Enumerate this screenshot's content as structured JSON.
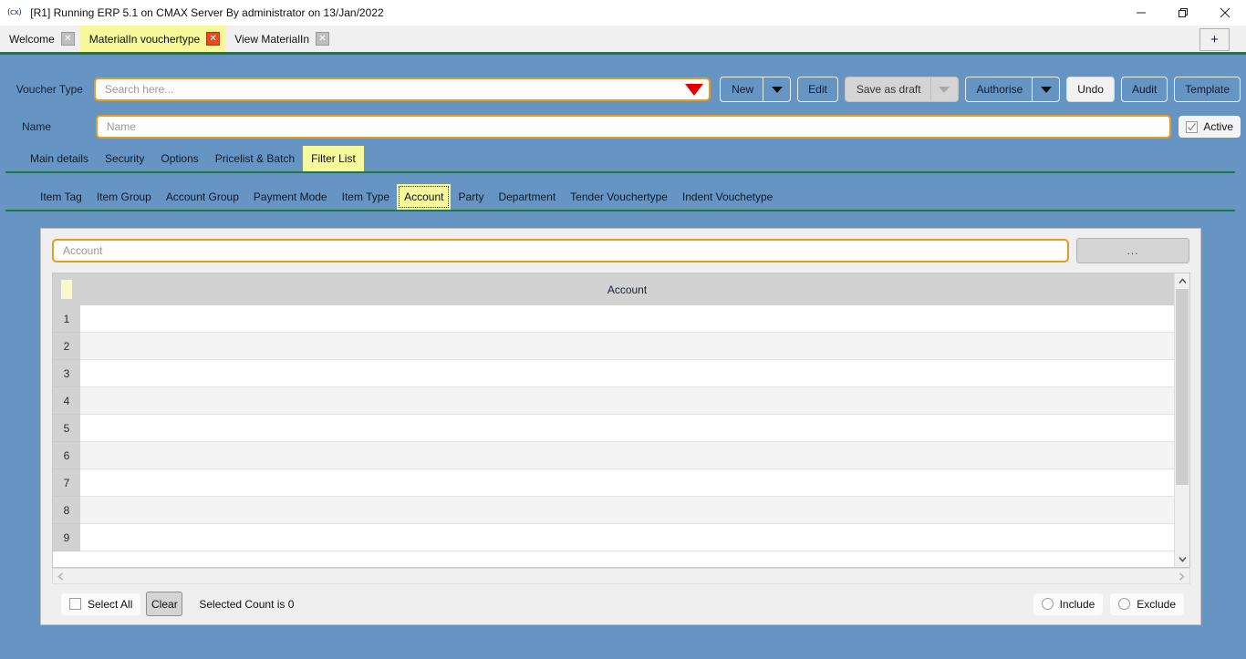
{
  "window": {
    "title": "[R1] Running ERP 5.1 on CMAX Server By administrator on 13/Jan/2022",
    "app_glyph": "(cx)",
    "minimize_icon": "minimize-icon",
    "maximize_icon": "maximize-icon",
    "close_icon": "close-icon"
  },
  "tabstrip": {
    "new_tab_label": "+",
    "tabs": [
      {
        "label": "Welcome",
        "active": false,
        "close_icon": "close-icon"
      },
      {
        "label": "MaterialIn vouchertype",
        "active": true,
        "close_icon": "close-icon"
      },
      {
        "label": "View MaterialIn",
        "active": false,
        "close_icon": "close-icon"
      }
    ]
  },
  "form": {
    "voucher_type_label": "Voucher Type",
    "voucher_type_placeholder": "Search here...",
    "voucher_type_value": "",
    "dropdown_icon": "caret-down-icon",
    "name_label": "Name",
    "name_placeholder": "Name",
    "name_value": "",
    "active_label": "Active",
    "active_checked": true
  },
  "toolbar": {
    "new_label": "New",
    "edit_label": "Edit",
    "save_as_draft_label": "Save as draft",
    "authorise_label": "Authorise",
    "undo_label": "Undo",
    "audit_label": "Audit",
    "template_label": "Template"
  },
  "tabs_primary": [
    {
      "label": "Main details",
      "active": false
    },
    {
      "label": "Security",
      "active": false
    },
    {
      "label": "Options",
      "active": false
    },
    {
      "label": "Pricelist & Batch",
      "active": false
    },
    {
      "label": "Filter List",
      "active": true
    }
  ],
  "tabs_secondary": [
    {
      "label": "Item Tag",
      "active": false
    },
    {
      "label": "Item Group",
      "active": false
    },
    {
      "label": "Account Group",
      "active": false
    },
    {
      "label": "Payment Mode",
      "active": false
    },
    {
      "label": "Item Type",
      "active": false
    },
    {
      "label": "Account",
      "active": true
    },
    {
      "label": "Party",
      "active": false
    },
    {
      "label": "Department",
      "active": false
    },
    {
      "label": "Tender Vouchertype",
      "active": false
    },
    {
      "label": "Indent Vouchetype",
      "active": false
    }
  ],
  "filter_panel": {
    "account_placeholder": "Account",
    "account_value": "",
    "browse_button_label": "...",
    "grid": {
      "column_header": "Account",
      "rows": [
        {
          "number": "1",
          "account": ""
        },
        {
          "number": "2",
          "account": ""
        },
        {
          "number": "3",
          "account": ""
        },
        {
          "number": "4",
          "account": ""
        },
        {
          "number": "5",
          "account": ""
        },
        {
          "number": "6",
          "account": ""
        },
        {
          "number": "7",
          "account": ""
        },
        {
          "number": "8",
          "account": ""
        },
        {
          "number": "9",
          "account": ""
        }
      ],
      "scroll_up_icon": "chevron-up-icon",
      "scroll_down_icon": "chevron-down-icon",
      "scroll_left_icon": "chevron-left-icon",
      "scroll_right_icon": "chevron-right-icon"
    },
    "select_all_label": "Select All",
    "select_all_checked": false,
    "clear_label": "Clear",
    "selected_count_text": "Selected Count is 0",
    "include_label": "Include",
    "include_selected": false,
    "exclude_label": "Exclude",
    "exclude_selected": false
  },
  "colors": {
    "body_blue": "#6795c3",
    "accent_green": "#1e7a3c",
    "tab_active_yellow": "#f7f79c",
    "field_orange": "#e79b22",
    "close_red": "#e8491f"
  }
}
